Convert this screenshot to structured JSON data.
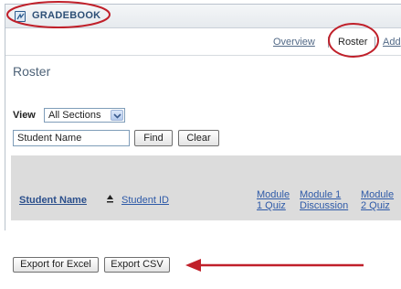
{
  "tool": {
    "title": "GRADEBOOK",
    "icon": "gradebook-icon"
  },
  "nav": {
    "overview": "Overview",
    "roster": "Roster",
    "add": "Add"
  },
  "page": {
    "title": "Roster"
  },
  "filter": {
    "view_label": "View",
    "section_selected": "All Sections",
    "search_value": "Student Name",
    "find_label": "Find",
    "clear_label": "Clear"
  },
  "table": {
    "columns": {
      "student_name": "Student Name",
      "student_id": "Student ID",
      "module1_quiz_line1": "Module",
      "module1_quiz_line2": "1 Quiz",
      "module1_disc_line1": "Module 1",
      "module1_disc_line2": "Discussion",
      "module2_quiz_line1": "Module",
      "module2_quiz_line2": "2 Quiz"
    }
  },
  "export": {
    "excel_label": "Export for Excel",
    "csv_label": "Export CSV"
  },
  "colors": {
    "annotation": "#c0202a",
    "link": "#2e5aa8",
    "header_bg": "#dcdcdc"
  }
}
